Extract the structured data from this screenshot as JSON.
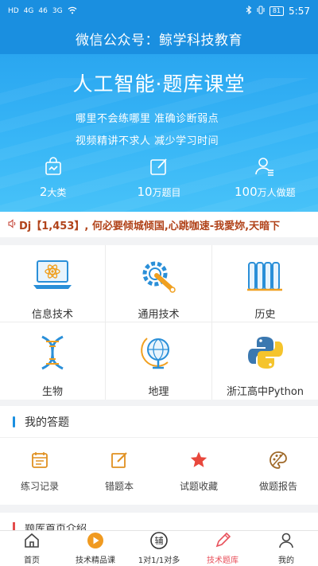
{
  "status": {
    "left_icons": [
      "HD",
      "4G",
      "46",
      "3G",
      "wifi"
    ],
    "battery": "81",
    "time": "5:57"
  },
  "title": "微信公众号：鲸学科技教育",
  "hero": {
    "title": "人工智能·题库课堂",
    "line1": "哪里不会练哪里  准确诊断弱点",
    "line2": "视频精讲不求人  减少学习时间",
    "stats": [
      {
        "icon": "bag-icon",
        "num": "2",
        "unit": "大类"
      },
      {
        "icon": "edit-icon",
        "num": "10",
        "unit": "万题目"
      },
      {
        "icon": "user-icon",
        "num": "100",
        "unit": "万人做题"
      }
    ]
  },
  "marquee": {
    "text": "Dj【1,453】, 何必要倾城倾国,心跳咖速-我愛妳,天暗下"
  },
  "subjects": [
    {
      "label": "信息技术",
      "icon": "laptop-atom-icon"
    },
    {
      "label": "通用技术",
      "icon": "wrench-gear-icon"
    },
    {
      "label": "历史",
      "icon": "scroll-icon"
    },
    {
      "label": "生物",
      "icon": "dna-icon"
    },
    {
      "label": "地理",
      "icon": "globe-icon"
    },
    {
      "label": "浙江高中Python",
      "icon": "python-icon"
    }
  ],
  "my_answers": {
    "title": "我的答题",
    "actions": [
      {
        "label": "练习记录",
        "icon": "calendar-icon"
      },
      {
        "label": "错题本",
        "icon": "edit-book-icon"
      },
      {
        "label": "试题收藏",
        "icon": "star-icon"
      },
      {
        "label": "做题报告",
        "icon": "palette-icon"
      }
    ]
  },
  "next_section": {
    "title": "题库首页介绍"
  },
  "tabs": [
    {
      "label": "首页",
      "icon": "home-icon"
    },
    {
      "label": "技术精品课",
      "icon": "play-icon"
    },
    {
      "label": "1对1/1对多",
      "icon": "tutor-icon",
      "glyph": "辅"
    },
    {
      "label": "技术题库",
      "icon": "pen-icon",
      "active": true
    },
    {
      "label": "我的",
      "icon": "person-icon"
    }
  ],
  "colors": {
    "primary": "#1a8fe0",
    "accent_red": "#e8505b",
    "icon_orange": "#f0a020",
    "icon_blue": "#2a8fd8"
  }
}
